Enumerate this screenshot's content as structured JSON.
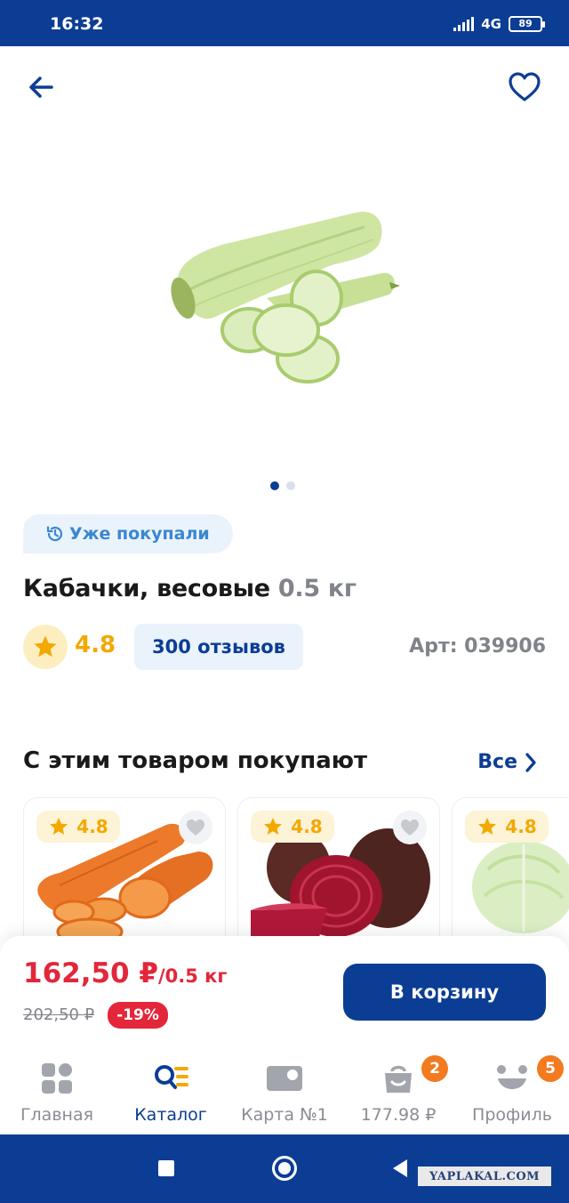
{
  "status_bar": {
    "time": "16:32",
    "network": "4G",
    "battery": "89"
  },
  "product": {
    "tag_label": "Уже покупали",
    "name": "Кабачки, весовые",
    "weight": "0.5 кг",
    "rating": "4.8",
    "reviews_label": "300 отзывов",
    "article": "Арт: 039906"
  },
  "related": {
    "title": "С этим товаром покупают",
    "see_all": "Все",
    "items": [
      {
        "rating": "4.8",
        "image": "carrot"
      },
      {
        "rating": "4.8",
        "image": "beetroot"
      },
      {
        "rating": "4.8",
        "image": "cabbage"
      }
    ]
  },
  "price": {
    "current": "162,50 ₽",
    "unit": "/0.5 кг",
    "old": "202,50 ₽",
    "discount": "-19%",
    "cart_button": "В корзину"
  },
  "tabs": [
    {
      "label": "Главная",
      "icon": "grid-icon"
    },
    {
      "label": "Каталог",
      "icon": "catalog-search-icon",
      "active": true
    },
    {
      "label": "Карта №1",
      "icon": "loyalty-card-icon"
    },
    {
      "label": "177.98 ₽",
      "icon": "cart-bag-icon",
      "badge": "2"
    },
    {
      "label": "Профиль",
      "icon": "profile-face-icon",
      "badge": "5"
    }
  ],
  "watermark": "YAPLAKAL.COM",
  "colors": {
    "brand_blue": "#0c3d94",
    "price_red": "#e3263a",
    "rating_yellow": "#f2a900",
    "badge_orange": "#f47a1f"
  }
}
